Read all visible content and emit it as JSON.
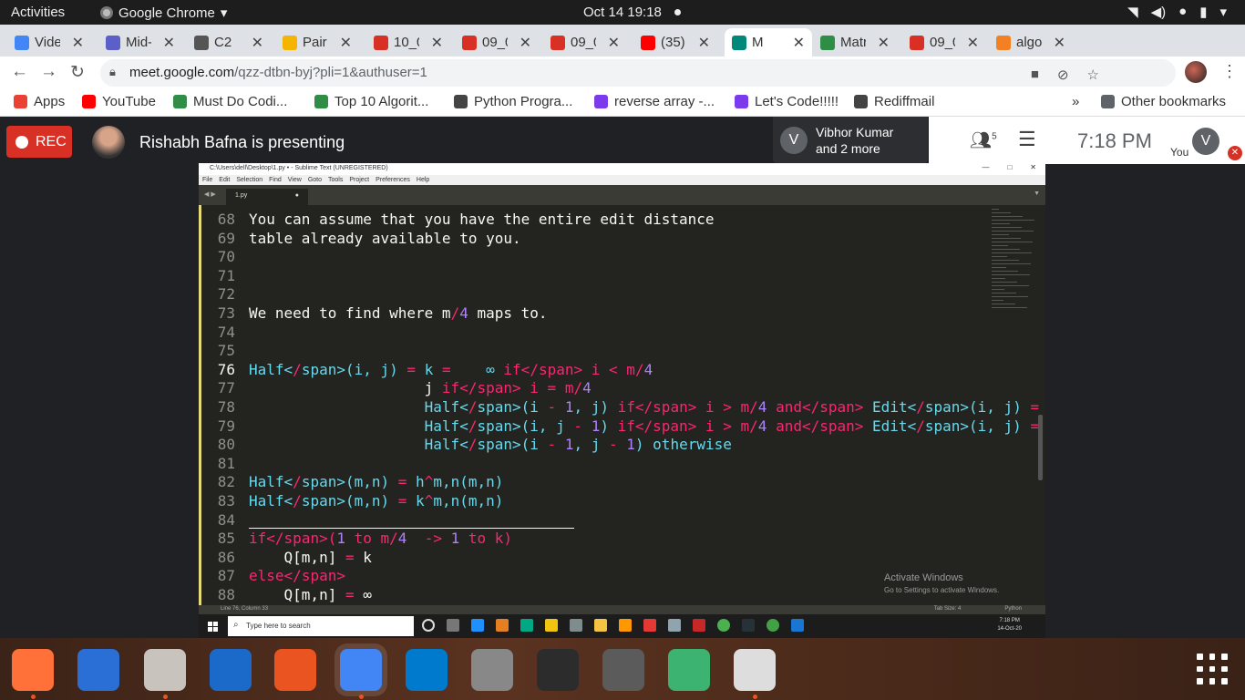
{
  "topbar": {
    "activities": "Activities",
    "app_name": "Google Chrome",
    "datetime": "Oct 14  19:18"
  },
  "tabs": [
    {
      "label": "Vide",
      "color": "#4285f4"
    },
    {
      "label": "Mid-",
      "color": "#5b5fc7"
    },
    {
      "label": "C2",
      "color": "#555"
    },
    {
      "label": "Pair",
      "color": "#f4b400"
    },
    {
      "label": "10_0",
      "color": "#d93025"
    },
    {
      "label": "09_0",
      "color": "#d93025"
    },
    {
      "label": "09_0",
      "color": "#d93025"
    },
    {
      "label": "(35)",
      "color": "#ff0000"
    },
    {
      "label": "M",
      "color": "#00897b"
    },
    {
      "label": "Matr",
      "color": "#2f8d46"
    },
    {
      "label": "09_0",
      "color": "#d93025"
    },
    {
      "label": "algo",
      "color": "#f48024"
    }
  ],
  "address": {
    "domain": "meet.google.com",
    "path": "/qzz-dtbn-byj?pli=1&authuser=1"
  },
  "bookmarks": [
    {
      "label": "Apps",
      "color": "#e94235"
    },
    {
      "label": "YouTube",
      "color": "#ff0000"
    },
    {
      "label": "Must Do Codi...",
      "color": "#2f8d46"
    },
    {
      "label": "Top 10 Algorit...",
      "color": "#2f8d46"
    },
    {
      "label": "Python Progra...",
      "color": "#444"
    },
    {
      "label": "reverse array -...",
      "color": "#7c3aed"
    },
    {
      "label": "Let's Code!!!!!",
      "color": "#7c3aed"
    },
    {
      "label": "Rediffmail",
      "color": "#444"
    }
  ],
  "other_bookmarks": "Other bookmarks",
  "meet": {
    "rec": "REC",
    "presenting": "Rishabh Bafna is presenting",
    "participant_initial": "V",
    "participant_name_line1": "Vibhor Kumar",
    "participant_name_line2": "and 2 more",
    "people_count": "5",
    "time": "7:18 PM",
    "you": "You",
    "you_initial": "V"
  },
  "sublime": {
    "title": "C:\\Users\\dell\\Desktop\\1.py • - Sublime Text (UNREGISTERED)",
    "menu": [
      "File",
      "Edit",
      "Selection",
      "Find",
      "View",
      "Goto",
      "Tools",
      "Project",
      "Preferences",
      "Help"
    ],
    "tab": "1.py",
    "status_left": "Line 76, Column 33",
    "status_tab": "Tab Size: 4",
    "status_lang": "Python",
    "activate_title": "Activate Windows",
    "activate_sub": "Go to Settings to activate Windows.",
    "search_placeholder": "Type here to search",
    "win_time": "7:18 PM",
    "win_date": "14-Oct-20",
    "lines": [
      {
        "n": "68",
        "text": "You can assume that you have the entire edit distance"
      },
      {
        "n": "69",
        "text": "table already available to you."
      },
      {
        "n": "70",
        "text": ""
      },
      {
        "n": "71",
        "text": ""
      },
      {
        "n": "72",
        "text": ""
      },
      {
        "n": "73",
        "text": "We need to find where m/4 maps to."
      },
      {
        "n": "74",
        "text": ""
      },
      {
        "n": "75",
        "text": ""
      },
      {
        "n": "76",
        "text": "Half(i, j) = k =    ∞ if i < m/4"
      },
      {
        "n": "77",
        "text": "                    j if i = m/4"
      },
      {
        "n": "78",
        "text": "                    Half(i - 1, j) if i > m/4 and Edit(i, j) = Edit(i - 1, j) + 1"
      },
      {
        "n": "79",
        "text": "                    Half(i, j - 1) if i > m/4 and Edit(i, j) = Edit(i, j - 1) + 1"
      },
      {
        "n": "80",
        "text": "                    Half(i - 1, j - 1) otherwise"
      },
      {
        "n": "81",
        "text": ""
      },
      {
        "n": "82",
        "text": "Half(m,n) = h^m,n(m,n)"
      },
      {
        "n": "83",
        "text": "Half(m,n) = k^m,n(m,n)"
      },
      {
        "n": "84",
        "text": ""
      },
      {
        "n": "85",
        "text": "if(1 to m/4  -> 1 to k)"
      },
      {
        "n": "86",
        "text": "    Q[m,n] = k"
      },
      {
        "n": "87",
        "text": "else"
      },
      {
        "n": "88",
        "text": "    Q[m,n] = ∞"
      }
    ]
  },
  "dock": [
    {
      "name": "firefox-icon",
      "color": "#ff7139",
      "running": true
    },
    {
      "name": "thunderbird-icon",
      "color": "#2a6fd6",
      "running": false
    },
    {
      "name": "files-icon",
      "color": "#c8c3bd",
      "running": true
    },
    {
      "name": "writer-icon",
      "color": "#1b6ac9",
      "running": false
    },
    {
      "name": "software-center-icon",
      "color": "#e95420",
      "running": false
    },
    {
      "name": "chrome-icon",
      "color": "#4285f4",
      "running": true
    },
    {
      "name": "vscode-icon",
      "color": "#007acc",
      "running": false
    },
    {
      "name": "settings-icon",
      "color": "#888",
      "running": false
    },
    {
      "name": "terminal-icon",
      "color": "#2c2c2c",
      "running": false
    },
    {
      "name": "atom-editor-icon",
      "color": "#5b5b5b",
      "running": false
    },
    {
      "name": "atom-icon",
      "color": "#3cb371",
      "running": false
    },
    {
      "name": "text-editor-icon",
      "color": "#ddd",
      "running": true
    }
  ]
}
